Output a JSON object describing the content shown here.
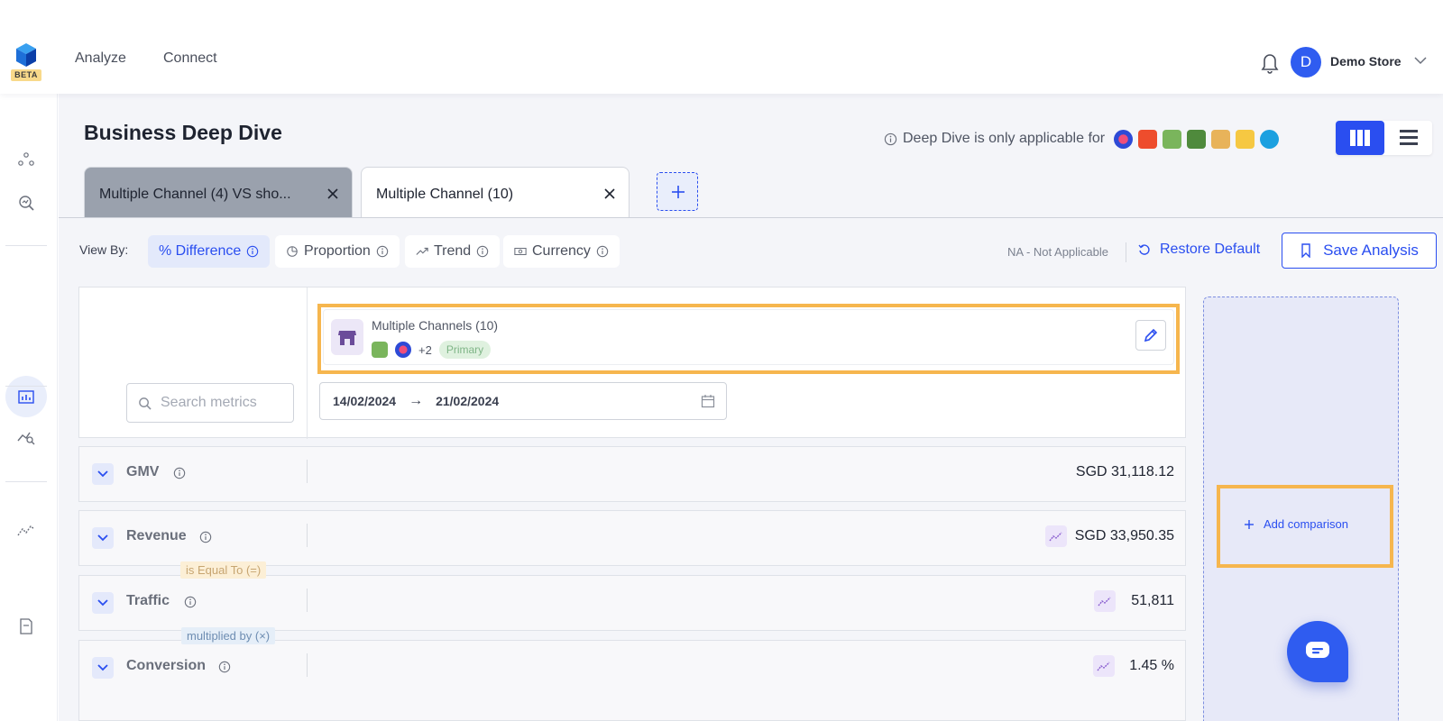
{
  "app": {
    "beta_label": "BETA",
    "nav": [
      "Analyze",
      "Connect"
    ],
    "user": {
      "initial": "D",
      "store": "Demo Store"
    }
  },
  "page": {
    "title": "Business Deep Dive",
    "notice": "Deep Dive is only applicable for"
  },
  "tabs": [
    {
      "label": "Multiple Channel (4) VS sho...",
      "active": false
    },
    {
      "label": "Multiple Channel (10)",
      "active": true
    }
  ],
  "view_by": {
    "label": "View By:",
    "options": [
      "% Difference",
      "Proportion",
      "Trend",
      "Currency"
    ],
    "selected": "% Difference"
  },
  "toolbar": {
    "na_text": "NA - Not Applicable",
    "restore_label": "Restore Default",
    "save_label": "Save Analysis"
  },
  "search": {
    "placeholder": "Search metrics"
  },
  "channel": {
    "title": "Multiple Channels (10)",
    "more": "+2",
    "badge": "Primary",
    "date_from": "14/02/2024",
    "date_arrow": "→",
    "date_to": "21/02/2024"
  },
  "metrics": [
    {
      "name": "GMV",
      "value": "SGD 31,118.12"
    },
    {
      "name": "Revenue",
      "value": "SGD 33,950.35"
    },
    {
      "name": "Traffic",
      "value": "51,811"
    },
    {
      "name": "Conversion",
      "value": "1.45 %"
    }
  ],
  "operators": [
    "is Equal To (=)",
    "multiplied by (×)"
  ],
  "comparison": {
    "add_label": "Add comparison"
  },
  "colors": {
    "accent": "#2a4ef0",
    "highlight": "#f6b64e"
  }
}
